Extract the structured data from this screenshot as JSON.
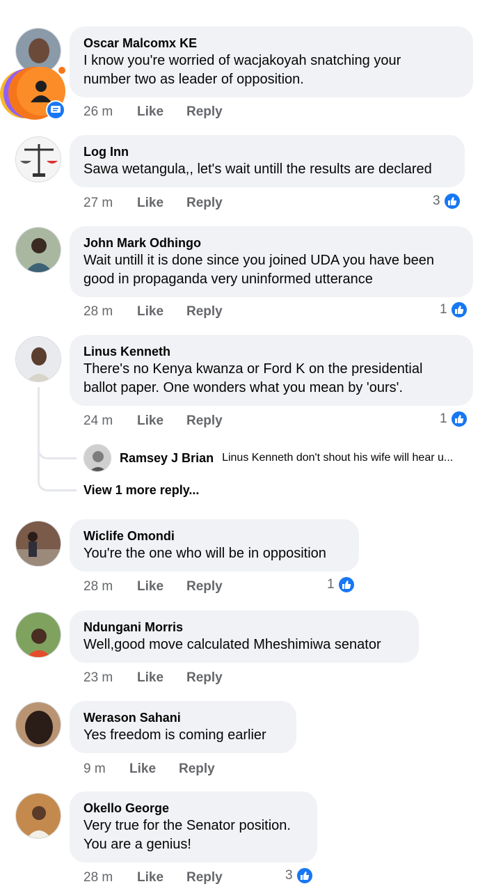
{
  "comments": [
    {
      "name": "Oscar Malcomx KE",
      "lines": [
        "I know you're worried of wacjakoyah snatching your",
        "number two as leader of opposition."
      ],
      "time": "26 m",
      "like": "Like",
      "reply": "Reply",
      "likes": ""
    },
    {
      "name": "Log Inn",
      "lines": [
        "Sawa wetangula,, let's wait untill the results are declared"
      ],
      "time": "27 m",
      "like": "Like",
      "reply": "Reply",
      "likes": "3"
    },
    {
      "name": "John Mark Odhingo",
      "lines": [
        "Wait untill it is done since you joined UDA you have been",
        "good in propaganda very uninformed utterance"
      ],
      "time": "28 m",
      "like": "Like",
      "reply": "Reply",
      "likes": "1"
    },
    {
      "name": "Linus Kenneth",
      "lines": [
        "There's no Kenya kwanza or Ford K on the presidential",
        "ballot paper. One wonders what you mean by 'ours'."
      ],
      "time": "24 m",
      "like": "Like",
      "reply": "Reply",
      "likes": "1"
    },
    {
      "name": "Wiclife Omondi",
      "lines": [
        "You're the one who will be in opposition"
      ],
      "time": "28 m",
      "like": "Like",
      "reply": "Reply",
      "likes": "1"
    },
    {
      "name": "Ndungani Morris",
      "lines": [
        "Well,good move calculated Mheshimiwa senator"
      ],
      "time": "23 m",
      "like": "Like",
      "reply": "Reply",
      "likes": ""
    },
    {
      "name": "Werason Sahani",
      "lines": [
        "Yes freedom is coming earlier"
      ],
      "time": "9 m",
      "like": "Like",
      "reply": "Reply",
      "likes": ""
    },
    {
      "name": "Okello George",
      "lines": [
        "Very true for the Senator position.",
        "You are a genius!"
      ],
      "time": "28 m",
      "like": "Like",
      "reply": "Reply",
      "likes": "3"
    }
  ],
  "nested_reply": {
    "name": "Ramsey J Brian",
    "text": "Linus Kenneth don't shout his wife will hear u..."
  },
  "view_more": "View 1 more reply...",
  "colors": {
    "bubble": "#f0f2f5",
    "like_blue": "#1877f2",
    "muted": "#65676b"
  }
}
